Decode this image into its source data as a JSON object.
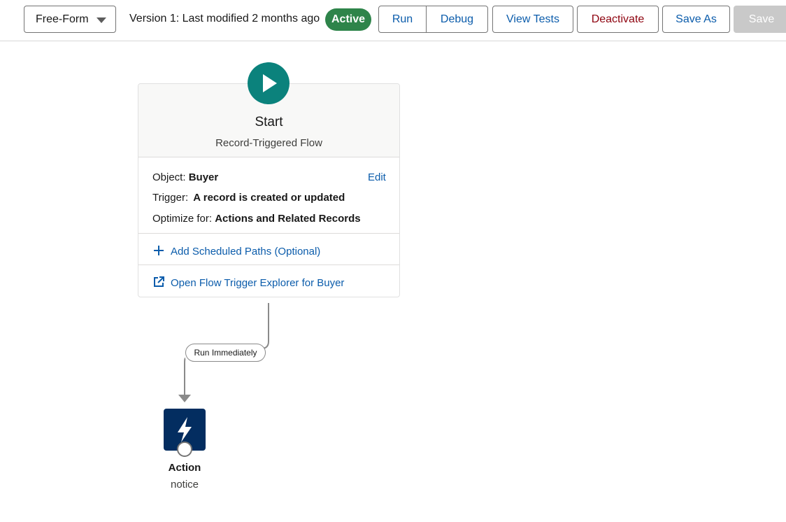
{
  "toolbar": {
    "layout_select": "Free-Form",
    "version_text": "Version 1: Last modified 2 months ago",
    "status": "Active",
    "buttons": {
      "run": "Run",
      "debug": "Debug",
      "view_tests": "View Tests",
      "deactivate": "Deactivate",
      "save_as": "Save As",
      "save": "Save"
    }
  },
  "start": {
    "title": "Start",
    "subtitle": "Record-Triggered Flow",
    "object_label": "Object:",
    "object_value": "Buyer",
    "edit": "Edit",
    "trigger_label": "Trigger:",
    "trigger_value": "A record is created or updated",
    "optimize_label": "Optimize for:",
    "optimize_value": "Actions and Related Records",
    "add_paths": "Add Scheduled Paths (Optional)",
    "open_explorer": "Open Flow Trigger Explorer for Buyer"
  },
  "connector": {
    "label": "Run Immediately"
  },
  "action": {
    "title": "Action",
    "subtitle": "notice"
  },
  "colors": {
    "brand_blue": "#0b5cab",
    "active_green": "#2e844a",
    "start_teal": "#0b827c",
    "action_navy": "#032d60",
    "deactivate_red": "#8e030f"
  }
}
